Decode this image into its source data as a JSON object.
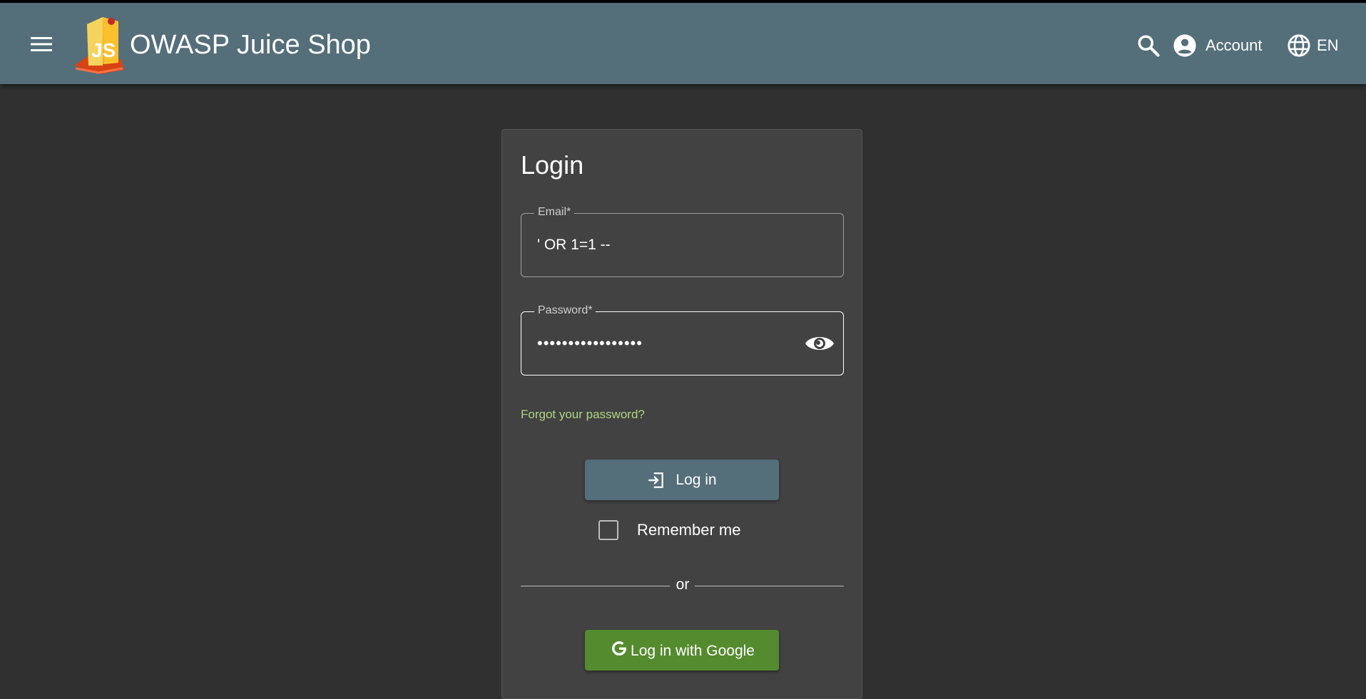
{
  "header": {
    "app_title": "OWASP Juice Shop",
    "account_label": "Account",
    "language_label": "EN",
    "bar_color": "#546e7a"
  },
  "login_card": {
    "title": "Login",
    "email_label": "Email*",
    "email_value": "' OR 1=1 --",
    "password_label": "Password*",
    "password_value": "•••••••••••••••••",
    "forgot_link": "Forgot your password?",
    "login_button": "Log in",
    "remember_me": "Remember me",
    "remember_checked": false,
    "divider_text": "or",
    "google_button": "Log in with Google"
  },
  "icons": {
    "menu": "hamburger-menu-icon",
    "search": "search-icon",
    "account": "account-circle-icon",
    "language": "globe-icon",
    "password_visibility": "eye-icon",
    "login": "login-arrow-icon",
    "google": "google-g-icon"
  },
  "colors": {
    "background": "#303030",
    "card": "#424242",
    "link": "#aed581",
    "google_button": "#558b2f"
  }
}
